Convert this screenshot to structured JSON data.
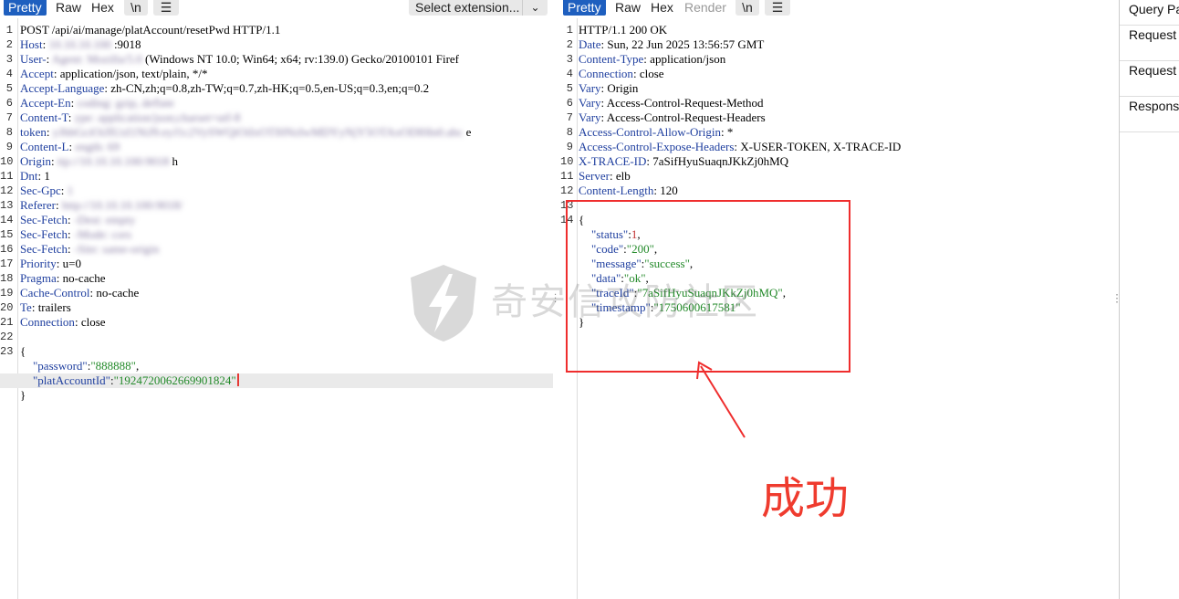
{
  "request": {
    "tabs": [
      "Pretty",
      "Raw",
      "Hex"
    ],
    "newline_button": "\\n",
    "menu_icon": "hamburger-menu-icon",
    "extension_select": "Select extension...",
    "lines": [
      {
        "n": "1",
        "key": "",
        "val": "POST /api/ai/manage/platAccount/resetPwd HTTP/1.1",
        "blur": ""
      },
      {
        "n": "2",
        "key": "Host",
        "val": ":9018",
        "blur": "10.10.10.100"
      },
      {
        "n": "3",
        "key": "User-",
        "val": "(Windows NT 10.0; Win64; x64; rv:139.0) Gecko/20100101 Firef",
        "blur": "Agent: Mozilla/5.0"
      },
      {
        "n": "4",
        "key": "Accept",
        "val": "application/json, text/plain, */*",
        "blur": ""
      },
      {
        "n": "5",
        "key": "Accept-Language",
        "val": "zh-CN,zh;q=0.8,zh-TW;q=0.7,zh-HK;q=0.5,en-US;q=0.3,en;q=0.2",
        "blur": ""
      },
      {
        "n": "6",
        "key": "Accept-En",
        "val": "",
        "blur": "coding: gzip, deflate"
      },
      {
        "n": "7",
        "key": "Content-T",
        "val": "",
        "blur": "ype: application/json;charset=utf-8"
      },
      {
        "n": "8",
        "key": "token",
        "val": "e",
        "blur": "yJhbGciOiJIUzI1NiJ9.eyJ1c2VySWQiOiIxOTI0NzIwMDYyNjY5OTAxODI0In0.abc"
      },
      {
        "n": "9",
        "key": "Content-L",
        "val": "",
        "blur": "ength: 69"
      },
      {
        "n": "10",
        "key": "Origin",
        "val": "h",
        "blur": "ttp://10.10.10.100:9018"
      },
      {
        "n": "11",
        "key": "Dnt",
        "val": "1",
        "blur": ""
      },
      {
        "n": "12",
        "key": "Sec-Gpc",
        "val": "",
        "blur": "1"
      },
      {
        "n": "13",
        "key": "Referer",
        "val": "",
        "blur": "http://10.10.10.100:9018/"
      },
      {
        "n": "14",
        "key": "Sec-Fetch",
        "val": "",
        "blur": "-Dest: empty"
      },
      {
        "n": "15",
        "key": "Sec-Fetch",
        "val": "",
        "blur": "-Mode: cors"
      },
      {
        "n": "16",
        "key": "Sec-Fetch",
        "val": "",
        "blur": "-Site: same-origin"
      },
      {
        "n": "17",
        "key": "Priority",
        "val": "u=0",
        "blur": ""
      },
      {
        "n": "18",
        "key": "Pragma",
        "val": "no-cache",
        "blur": ""
      },
      {
        "n": "19",
        "key": "Cache-Control",
        "val": "no-cache",
        "blur": ""
      },
      {
        "n": "20",
        "key": "Te",
        "val": "trailers",
        "blur": ""
      },
      {
        "n": "21",
        "key": "Connection",
        "val": "close",
        "blur": ""
      },
      {
        "n": "22",
        "key": "",
        "val": "",
        "blur": ""
      }
    ],
    "body": {
      "n_open": "23",
      "password_key": "\"password\"",
      "password_val": "\"888888\"",
      "account_key": "\"platAccountId\"",
      "account_val": "\"1924720062669901824\""
    }
  },
  "response": {
    "tabs": [
      "Pretty",
      "Raw",
      "Hex",
      "Render"
    ],
    "newline_button": "\\n",
    "menu_icon": "hamburger-menu-icon",
    "lines": [
      {
        "n": "1",
        "key": "",
        "val": "HTTP/1.1 200 OK"
      },
      {
        "n": "2",
        "key": "Date",
        "val": "Sun, 22 Jun 2025 13:56:57 GMT"
      },
      {
        "n": "3",
        "key": "Content-Type",
        "val": "application/json"
      },
      {
        "n": "4",
        "key": "Connection",
        "val": "close"
      },
      {
        "n": "5",
        "key": "Vary",
        "val": "Origin"
      },
      {
        "n": "6",
        "key": "Vary",
        "val": "Access-Control-Request-Method"
      },
      {
        "n": "7",
        "key": "Vary",
        "val": "Access-Control-Request-Headers"
      },
      {
        "n": "8",
        "key": "Access-Control-Allow-Origin",
        "val": "*"
      },
      {
        "n": "9",
        "key": "Access-Control-Expose-Headers",
        "val": "X-USER-TOKEN, X-TRACE-ID"
      },
      {
        "n": "10",
        "key": "X-TRACE-ID",
        "val": "7aSifHyuSuaqnJKkZj0hMQ"
      },
      {
        "n": "11",
        "key": "Server",
        "val": "elb"
      },
      {
        "n": "12",
        "key": "Content-Length",
        "val": "120"
      },
      {
        "n": "13",
        "key": "",
        "val": ""
      }
    ],
    "body": {
      "n_open": "14",
      "fields": [
        {
          "k": "\"status\"",
          "v": "1",
          "kind": "num",
          "comma": ","
        },
        {
          "k": "\"code\"",
          "v": "\"200\"",
          "kind": "str",
          "comma": ","
        },
        {
          "k": "\"message\"",
          "v": "\"success\"",
          "kind": "str",
          "comma": ","
        },
        {
          "k": "\"data\"",
          "v": "\"ok\"",
          "kind": "str",
          "comma": ","
        },
        {
          "k": "\"traceId\"",
          "v": "\"7aSifHyuSuaqnJKkZj0hMQ\"",
          "kind": "str",
          "comma": ","
        },
        {
          "k": "\"timestamp\"",
          "v": "\"1750600617581\"",
          "kind": "str",
          "comma": ""
        }
      ]
    }
  },
  "side_panel": {
    "items": [
      "Query Pa",
      "Request C",
      "Request H",
      "Response"
    ]
  },
  "annotation": {
    "label": "成功",
    "color": "#ef2d2d"
  },
  "watermark": {
    "text": "奇安信攻防社区"
  },
  "colors": {
    "active_tab": "#1e5fbf",
    "key": "#1f3f9f",
    "string": "#238a2a"
  }
}
